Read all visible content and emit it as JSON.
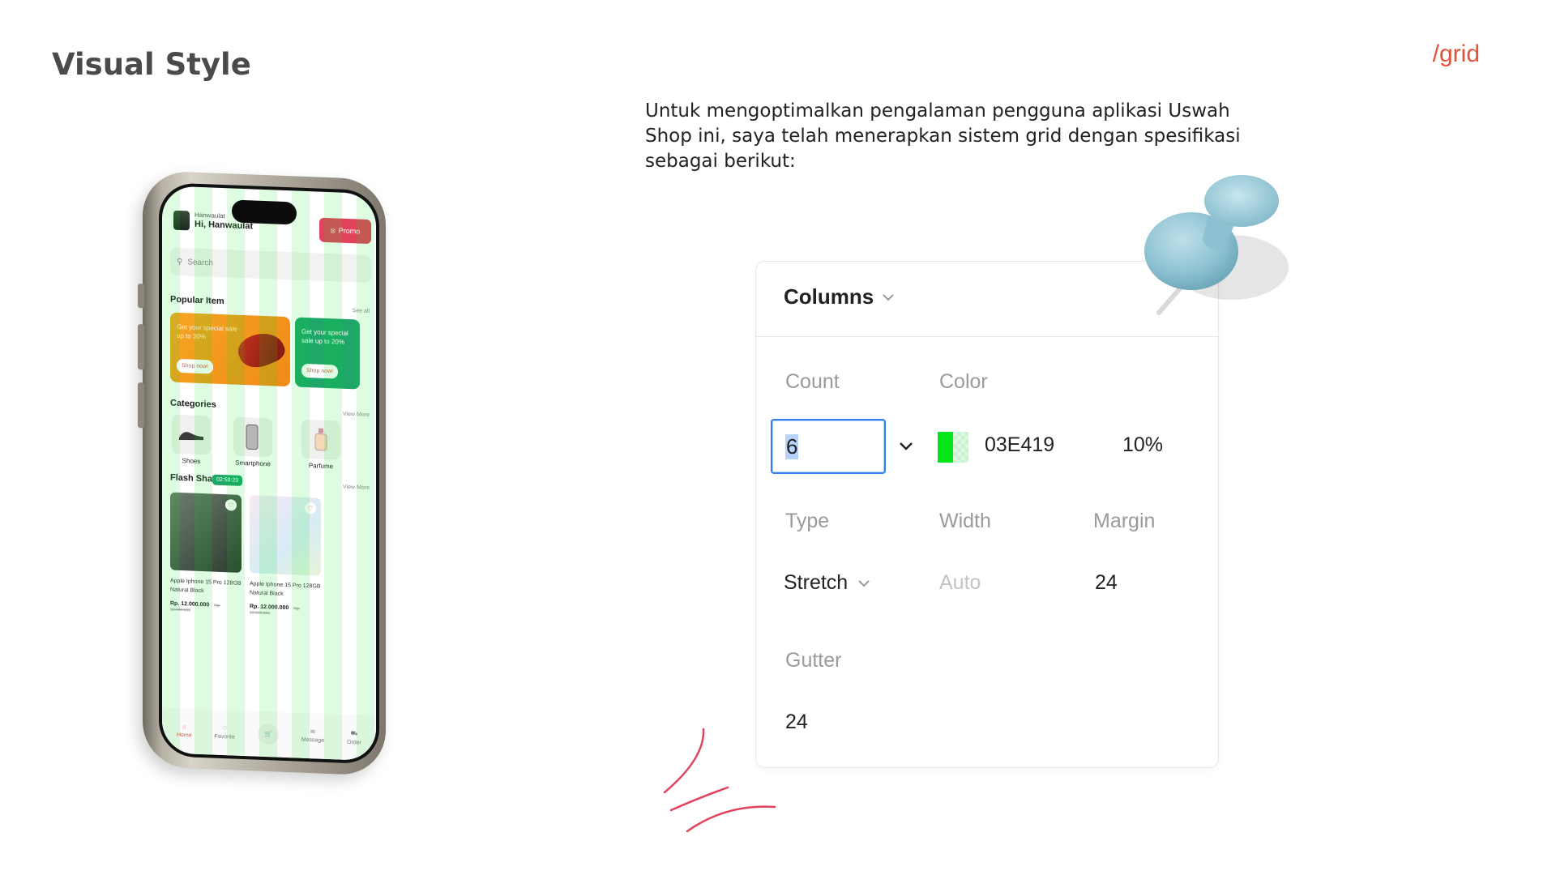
{
  "header": {
    "title": "Visual Style",
    "section_tag": "/grid"
  },
  "intro_text": "Untuk mengoptimalkan pengalaman pengguna aplikasi Uswah Shop ini, saya telah menerapkan sistem grid dengan spesifikasi sebagai berikut:",
  "colors": {
    "title": "#4a4a4a",
    "accent": "#e0533d",
    "grid_color": "#03E419",
    "focus_blue": "#2f7ff0",
    "app_green": "#1ea768",
    "app_red": "#e2435c"
  },
  "phone_app": {
    "greeting_small": "Hanwaulat",
    "greeting": "Hi, Hanwaulat",
    "promo_label": "Promo",
    "search_placeholder": "Search",
    "popular_title": "Popular Item",
    "popular_link": "See all",
    "banners": [
      {
        "text": "Get your special sale up to 30%",
        "button": "Shop now!"
      },
      {
        "text": "Get your special sale up to 20%",
        "button": "Shop now!"
      }
    ],
    "categories_title": "Categories",
    "categories_link": "View More",
    "categories": [
      "Shoes",
      "Smartphone",
      "Parfume"
    ],
    "flash_title": "Flash Shale",
    "flash_timer": "02:59:20",
    "flash_link": "View More",
    "products": [
      {
        "name": "Apple Iphone 15 Pro 128GB Natural Black",
        "price": "Rp. 12.000.000",
        "old_price": "Rp. 13.000.000"
      },
      {
        "name": "Apple Iphone 15 Pro 128GB Natural Black",
        "price": "Rp. 12.000.000",
        "old_price": "Rp. 13.000.000"
      }
    ],
    "tabs": [
      "Home",
      "Favorite",
      "",
      "Message",
      "Order"
    ],
    "tab_icons": [
      "home-icon",
      "heart-icon",
      "cart-icon",
      "message-icon",
      "truck-icon"
    ]
  },
  "grid_panel": {
    "section": "Columns",
    "count_label": "Count",
    "count_value": "6",
    "color_label": "Color",
    "color_hex": "03E419",
    "opacity": "10%",
    "type_label": "Type",
    "type_value": "Stretch",
    "width_label": "Width",
    "width_value": "Auto",
    "margin_label": "Margin",
    "margin_value": "24",
    "gutter_label": "Gutter",
    "gutter_value": "24"
  }
}
